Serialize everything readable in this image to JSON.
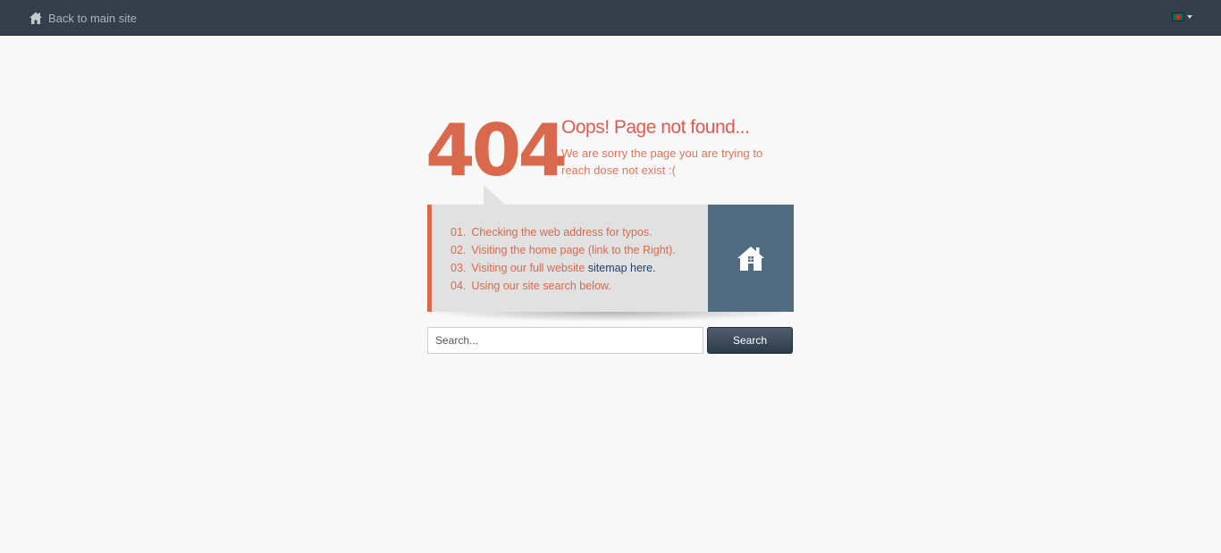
{
  "topbar": {
    "back_label": "Back to main site",
    "back_icon": "home-icon",
    "language_flag": "bangladesh-flag-icon"
  },
  "error": {
    "code": "404",
    "title": "Oops! Page not found...",
    "message": "We are sorry the page you are trying to reach dose not exist :("
  },
  "suggestions": [
    {
      "num": "01.",
      "text": "Checking the web address for typos."
    },
    {
      "num": "02.",
      "text": "Visiting the home page (link to the Right)."
    },
    {
      "num": "03.",
      "text": "Visiting our full website ",
      "link": "sitemap here."
    },
    {
      "num": "04.",
      "text": "Using our site search below."
    }
  ],
  "home_tile_icon": "home-icon",
  "search": {
    "placeholder": "Search...",
    "button_label": "Search"
  },
  "colors": {
    "accent": "#d9694c",
    "topbar": "#353f4b",
    "tile": "#4f6c80"
  }
}
